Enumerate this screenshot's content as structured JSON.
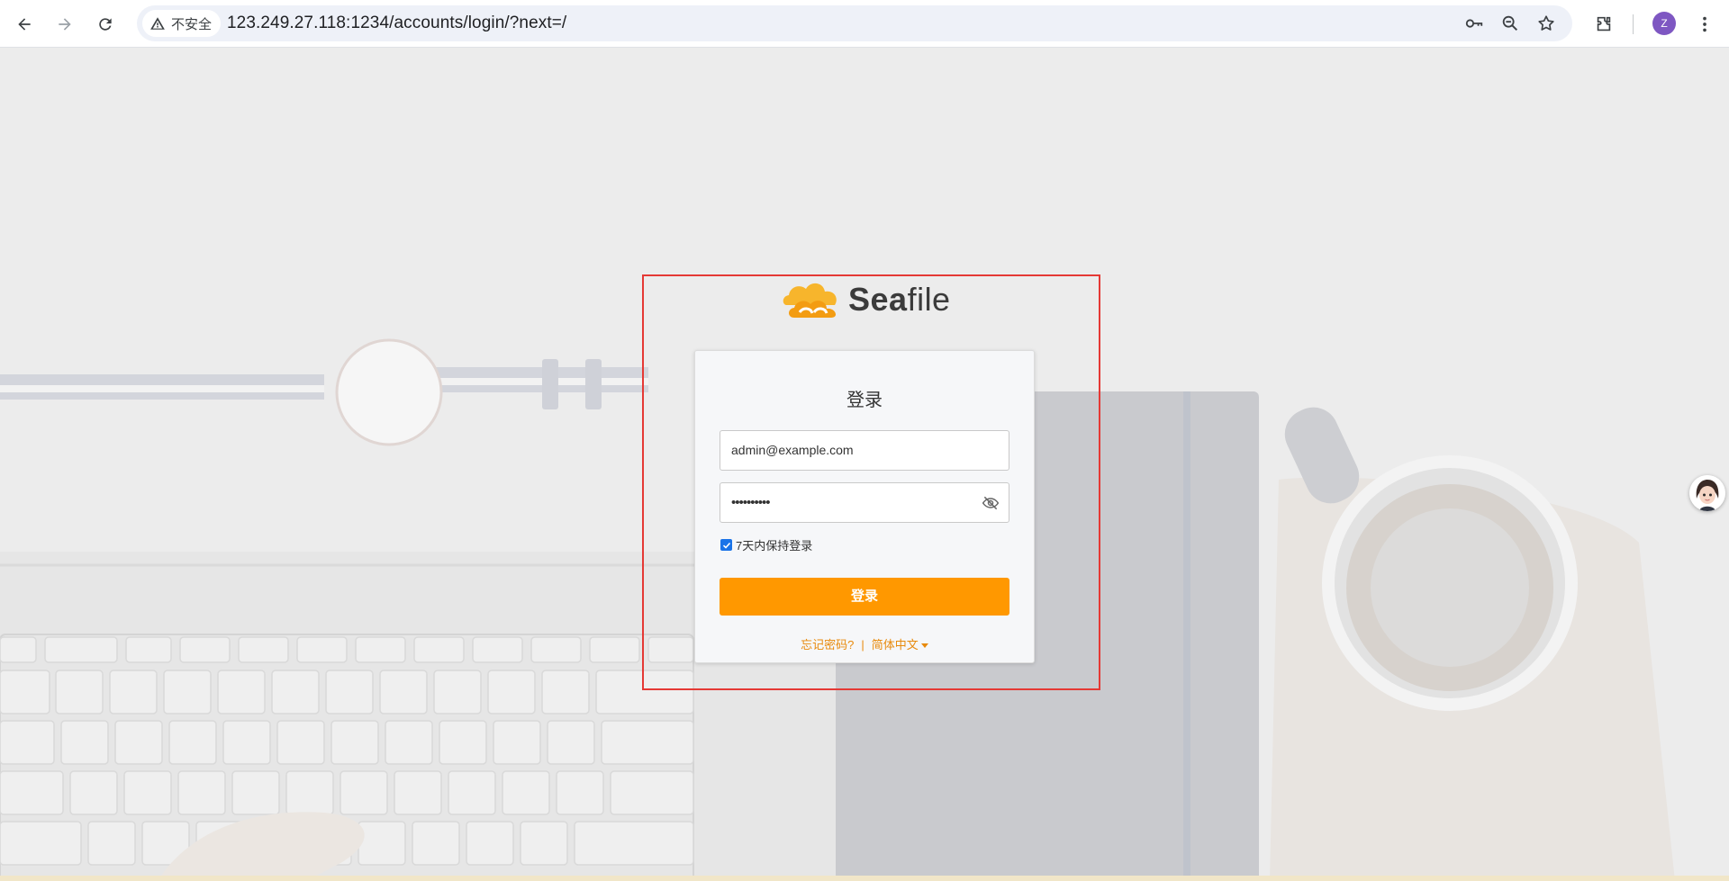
{
  "browser": {
    "security_label": "不安全",
    "url": "123.249.27.118:1234/accounts/login/?next=/",
    "profile_initial": "Z"
  },
  "brand": {
    "name_bold": "Sea",
    "name_rest": "file",
    "accent_color": "#ff9800"
  },
  "login": {
    "title": "登录",
    "username_value": "admin@example.com",
    "password_masked": "••••••••••",
    "remember_label": "7天内保持登录",
    "remember_checked": true,
    "submit_label": "登录",
    "forgot_link": "忘记密码?",
    "language_label": "简体中文"
  },
  "colors": {
    "highlight_box": "#e53935",
    "link": "#e88a0c",
    "button": "#ff9800"
  }
}
